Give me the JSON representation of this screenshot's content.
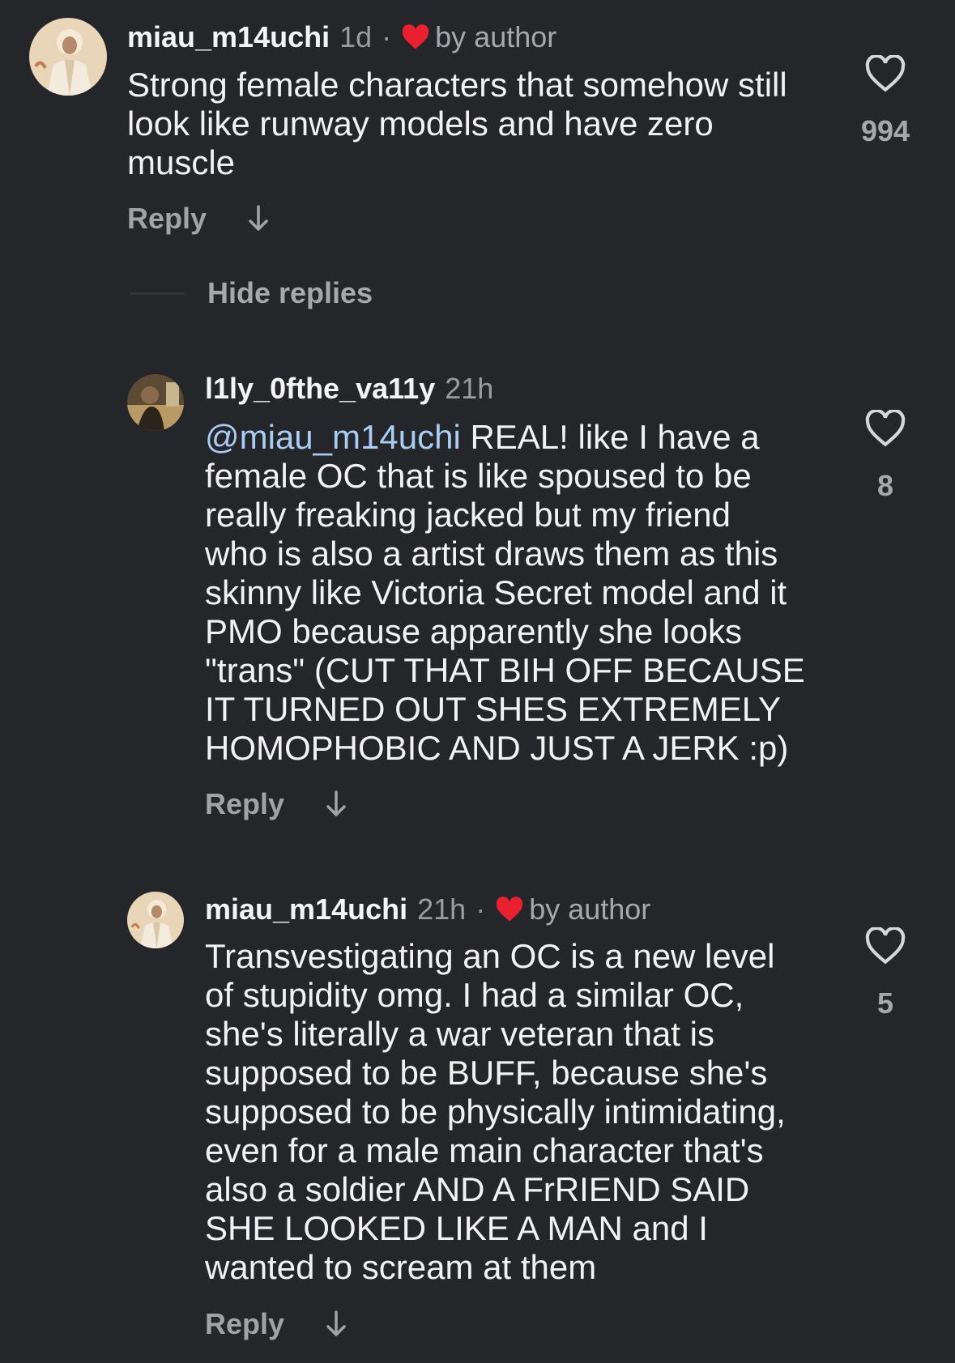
{
  "comments": [
    {
      "username": "miau_m14uchi",
      "time": "1d",
      "dot": "·",
      "by_author": "by author",
      "body_lines": [
        "Strong female characters that somehow still",
        "look like runway models and have zero",
        "muscle"
      ],
      "reply_label": "Reply",
      "likes": "994",
      "avatar_icon": "avatar-illustration-icon"
    },
    {
      "username": "l1ly_0fthe_va11y",
      "time": "21h",
      "mention": "@miau_m14uchi",
      "body_first_rest": " REAL! like I have a",
      "body_lines": [
        "female OC that is like spoused to be",
        "really freaking jacked but my friend",
        "who is also a artist draws them as this",
        "skinny like Victoria Secret model and it",
        "PMO because apparently she looks",
        "\"trans\" (CUT THAT BIH OFF BECAUSE",
        "IT TURNED OUT SHES EXTREMELY",
        "HOMOPHOBIC AND JUST A JERK :p)"
      ],
      "reply_label": "Reply",
      "likes": "8",
      "avatar_icon": "avatar-photo-icon"
    },
    {
      "username": "miau_m14uchi",
      "time": "21h",
      "dot": "·",
      "by_author": "by author",
      "body_lines": [
        "Transvestigating an OC is a new level",
        "of stupidity omg. I had a similar OC,",
        "she's literally a war veteran that is",
        "supposed to be BUFF, because she's",
        "supposed to be physically intimidating,",
        "even for a male main character that's",
        "also a soldier AND A FrRIEND SAID",
        "SHE LOOKED LIKE A MAN and I",
        "wanted to scream at them"
      ],
      "reply_label": "Reply",
      "likes": "5",
      "avatar_icon": "avatar-illustration-icon"
    }
  ],
  "hide_replies_label": "Hide replies",
  "colors": {
    "background": "#25262a",
    "author_heart": "#e8202f",
    "mention": "#a9cdf5",
    "muted": "#a6a8ae"
  }
}
